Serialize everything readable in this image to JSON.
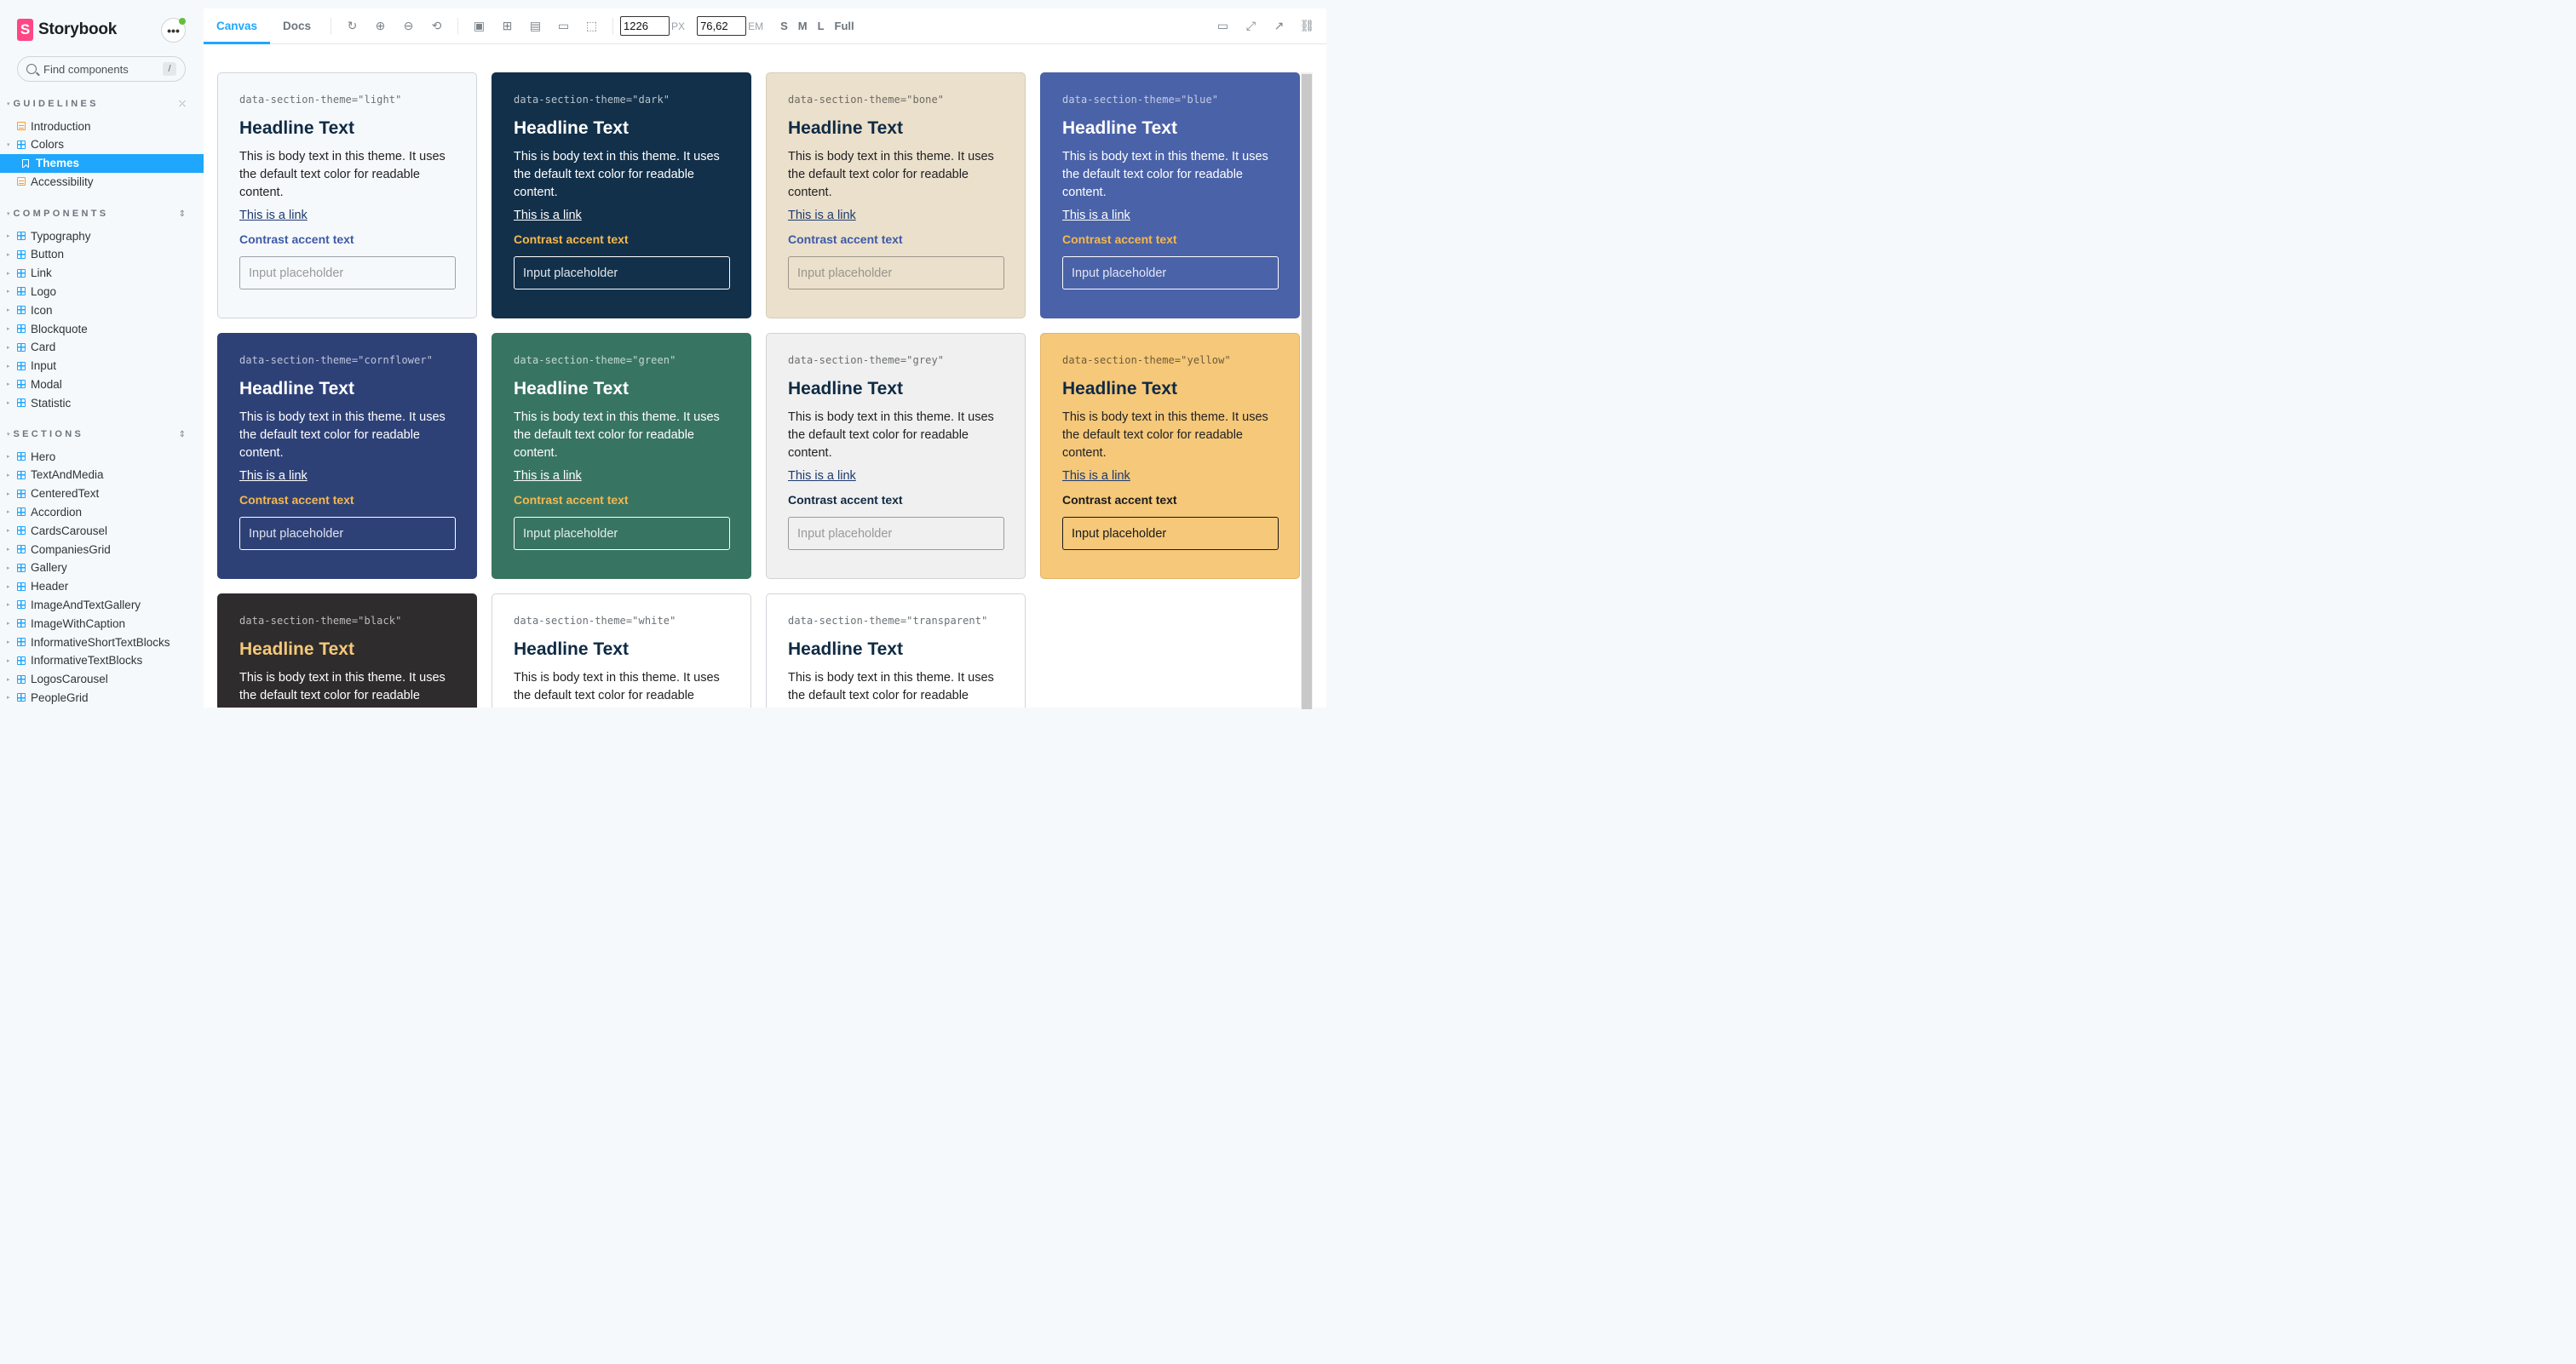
{
  "sidebar": {
    "brand": "Storybook",
    "search_placeholder": "Find components",
    "search_shortcut": "/",
    "groups": [
      {
        "title": "GUIDELINES",
        "items": [
          {
            "label": "Introduction",
            "icon": "doc-icon"
          },
          {
            "label": "Colors",
            "icon": "component-icon"
          },
          {
            "label": "Themes",
            "icon": "bookmark-icon",
            "selected": true
          },
          {
            "label": "Accessibility",
            "icon": "doc-icon"
          }
        ]
      },
      {
        "title": "COMPONENTS",
        "items": [
          {
            "label": "Typography"
          },
          {
            "label": "Button"
          },
          {
            "label": "Link"
          },
          {
            "label": "Logo"
          },
          {
            "label": "Icon"
          },
          {
            "label": "Blockquote"
          },
          {
            "label": "Card"
          },
          {
            "label": "Input"
          },
          {
            "label": "Modal"
          },
          {
            "label": "Statistic"
          }
        ]
      },
      {
        "title": "SECTIONS",
        "items": [
          {
            "label": "Hero"
          },
          {
            "label": "TextAndMedia"
          },
          {
            "label": "CenteredText"
          },
          {
            "label": "Accordion"
          },
          {
            "label": "CardsCarousel"
          },
          {
            "label": "CompaniesGrid"
          },
          {
            "label": "Gallery"
          },
          {
            "label": "Header"
          },
          {
            "label": "ImageAndTextGallery"
          },
          {
            "label": "ImageWithCaption"
          },
          {
            "label": "InformativeShortTextBlocks"
          },
          {
            "label": "InformativeTextBlocks"
          },
          {
            "label": "LogosCarousel"
          },
          {
            "label": "PeopleGrid"
          }
        ]
      }
    ]
  },
  "toolbar": {
    "tabs": [
      "Canvas",
      "Docs"
    ],
    "width_value": "1226",
    "width_unit": "PX",
    "height_value": "76,62",
    "height_unit": "EM",
    "viewports": [
      "S",
      "M",
      "L",
      "Full"
    ]
  },
  "cards": [
    {
      "attr": "data-section-theme=\"light\"",
      "headline": "Headline Text",
      "body": "This is body text in this theme. It uses the default text color for readable content.",
      "link": "This is a link",
      "accent": "Contrast accent text",
      "placeholder": "Input placeholder",
      "colors": {
        "bg": "#f6f9fc",
        "border": "#d0d5da",
        "attr": "#6a7075",
        "headline": "#0f2a44",
        "text": "#222",
        "link": "#1e3a6e",
        "accent": "#3d5aa6",
        "field_border": "#9aa1a7",
        "placeholder": "#999"
      }
    },
    {
      "attr": "data-section-theme=\"dark\"",
      "headline": "Headline Text",
      "body": "This is body text in this theme. It uses the default text color for readable content.",
      "link": "This is a link",
      "accent": "Contrast accent text",
      "placeholder": "Input placeholder",
      "colors": {
        "bg": "#12304a",
        "border": "#12304a",
        "attr": "#b9c3cc",
        "headline": "#ffffff",
        "text": "#ffffff",
        "link": "#ffffff",
        "accent": "#f5b84e",
        "field_border": "#ffffff",
        "placeholder": "#dde3e8"
      }
    },
    {
      "attr": "data-section-theme=\"bone\"",
      "headline": "Headline Text",
      "body": "This is body text in this theme. It uses the default text color for readable content.",
      "link": "This is a link",
      "accent": "Contrast accent text",
      "placeholder": "Input placeholder",
      "colors": {
        "bg": "#ebe0cc",
        "border": "#d6ccb8",
        "attr": "#6d6a63",
        "headline": "#0f2a44",
        "text": "#222",
        "link": "#1e3a6e",
        "accent": "#3d5aa6",
        "field_border": "#9c968b",
        "placeholder": "#9a958c"
      }
    },
    {
      "attr": "data-section-theme=\"blue\"",
      "headline": "Headline Text",
      "body": "This is body text in this theme. It uses the default text color for readable content.",
      "link": "This is a link",
      "accent": "Contrast accent text",
      "placeholder": "Input placeholder",
      "colors": {
        "bg": "#4a62a8",
        "border": "#4a62a8",
        "attr": "#c4cce6",
        "headline": "#ffffff",
        "text": "#ffffff",
        "link": "#ffffff",
        "accent": "#f5b84e",
        "field_border": "#ffffff",
        "placeholder": "#e1e6f4"
      }
    },
    {
      "attr": "data-section-theme=\"cornflower\"",
      "headline": "Headline Text",
      "body": "This is body text in this theme. It uses the default text color for readable content.",
      "link": "This is a link",
      "accent": "Contrast accent text",
      "placeholder": "Input placeholder",
      "colors": {
        "bg": "#2e4177",
        "border": "#2e4177",
        "attr": "#bcc4dc",
        "headline": "#ffffff",
        "text": "#ffffff",
        "link": "#ffffff",
        "accent": "#f5b84e",
        "field_border": "#ffffff",
        "placeholder": "#dfe3ee"
      }
    },
    {
      "attr": "data-section-theme=\"green\"",
      "headline": "Headline Text",
      "body": "This is body text in this theme. It uses the default text color for readable content.",
      "link": "This is a link",
      "accent": "Contrast accent text",
      "placeholder": "Input placeholder",
      "colors": {
        "bg": "#387462",
        "border": "#387462",
        "attr": "#c4d9d2",
        "headline": "#ffffff",
        "text": "#ffffff",
        "link": "#ffffff",
        "accent": "#f5b84e",
        "field_border": "#ffffff",
        "placeholder": "#e3eee9"
      }
    },
    {
      "attr": "data-section-theme=\"grey\"",
      "headline": "Headline Text",
      "body": "This is body text in this theme. It uses the default text color for readable content.",
      "link": "This is a link",
      "accent": "Contrast accent text",
      "placeholder": "Input placeholder",
      "colors": {
        "bg": "#f0f0f0",
        "border": "#d2d2d2",
        "attr": "#6a6d70",
        "headline": "#0f2a44",
        "text": "#222",
        "link": "#1e3a6e",
        "accent": "#0f2a44",
        "field_border": "#9a9a9a",
        "placeholder": "#999"
      }
    },
    {
      "attr": "data-section-theme=\"yellow\"",
      "headline": "Headline Text",
      "body": "This is body text in this theme. It uses the default text color for readable content.",
      "link": "This is a link",
      "accent": "Contrast accent text",
      "placeholder": "Input placeholder",
      "colors": {
        "bg": "#f5c87a",
        "border": "#e2b468",
        "attr": "#6e5a36",
        "headline": "#0f2a44",
        "text": "#222",
        "link": "#1e3a6e",
        "accent": "#1a1a1a",
        "field_border": "#1a1a1a",
        "placeholder": "#1a1a1a"
      }
    },
    {
      "attr": "data-section-theme=\"black\"",
      "headline": "Headline Text",
      "body": "This is body text in this theme. It uses the default text color for readable content.",
      "link": "",
      "accent": "",
      "placeholder": "",
      "colors": {
        "bg": "#2e2c2c",
        "border": "#2e2c2c",
        "attr": "#bdbdbd",
        "headline": "#f5c87a",
        "text": "#ffffff",
        "link": "#ffffff",
        "accent": "#f5b84e",
        "field_border": "#ffffff",
        "placeholder": "#ddd"
      }
    },
    {
      "attr": "data-section-theme=\"white\"",
      "headline": "Headline Text",
      "body": "This is body text in this theme. It uses the default text color for readable content.",
      "link": "",
      "accent": "",
      "placeholder": "",
      "colors": {
        "bg": "#ffffff",
        "border": "#d0d5da",
        "attr": "#6a7075",
        "headline": "#0f2a44",
        "text": "#222",
        "link": "#1e3a6e",
        "accent": "#3d5aa6",
        "field_border": "#9aa1a7",
        "placeholder": "#999"
      }
    },
    {
      "attr": "data-section-theme=\"transparent\"",
      "headline": "Headline Text",
      "body": "This is body text in this theme. It uses the default text color for readable content.",
      "link": "",
      "accent": "",
      "placeholder": "",
      "colors": {
        "bg": "#ffffff",
        "border": "#d0d5da",
        "attr": "#6a7075",
        "headline": "#0f2a44",
        "text": "#222",
        "link": "#1e3a6e",
        "accent": "#3d5aa6",
        "field_border": "#9aa1a7",
        "placeholder": "#999"
      }
    }
  ]
}
